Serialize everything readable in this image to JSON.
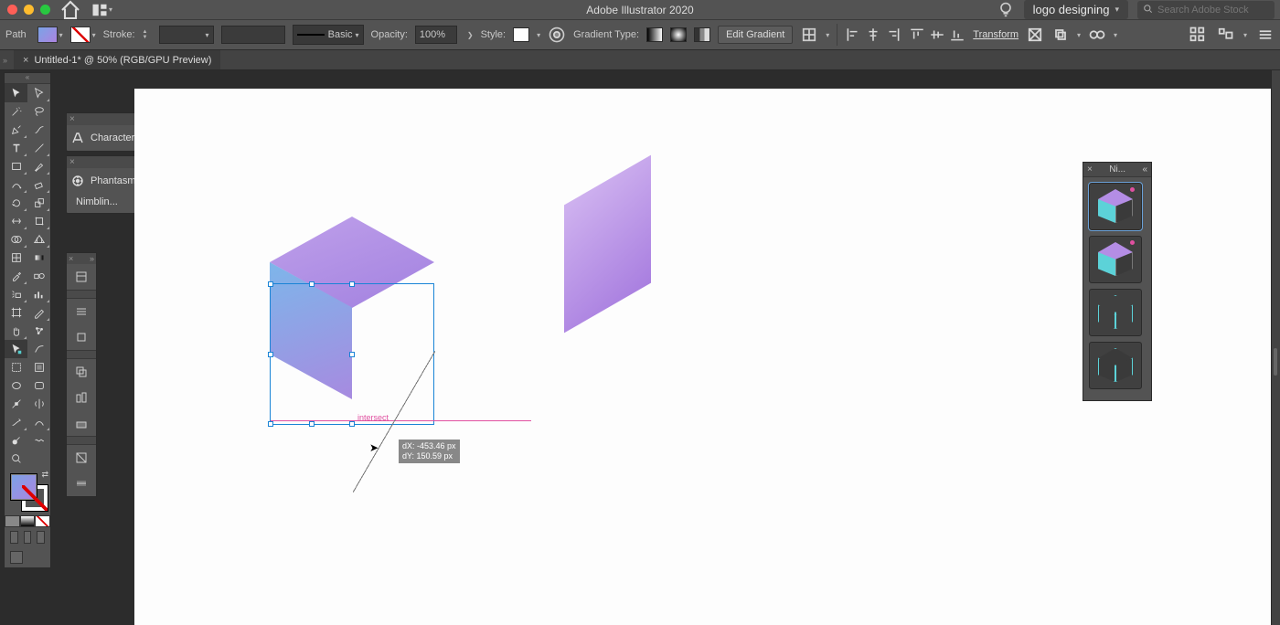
{
  "titlebar": {
    "app_title": "Adobe Illustrator 2020",
    "workspace": "logo designing",
    "search_placeholder": "Search Adobe Stock"
  },
  "ctrlbar": {
    "selection_type": "Path",
    "stroke_label": "Stroke:",
    "stroke_weight": "",
    "profile": "Basic",
    "opacity_label": "Opacity:",
    "opacity_value": "100%",
    "style_label": "Style:",
    "gradient_type_label": "Gradient Type:",
    "edit_gradient": "Edit Gradient",
    "transform": "Transform"
  },
  "tabs": {
    "doc1": {
      "name": "Untitled-1* @ 50% (RGB/GPU Preview)"
    }
  },
  "mini_panels": {
    "character": "Character",
    "phantasm": "Phantasm",
    "nimbling": "Nimblin..."
  },
  "canvas": {
    "smartguide": "intersect",
    "measure_dx": "dX: -453.46 px",
    "measure_dy": "dY: 150.59 px"
  },
  "sample_panel": {
    "title": "Ni..."
  }
}
